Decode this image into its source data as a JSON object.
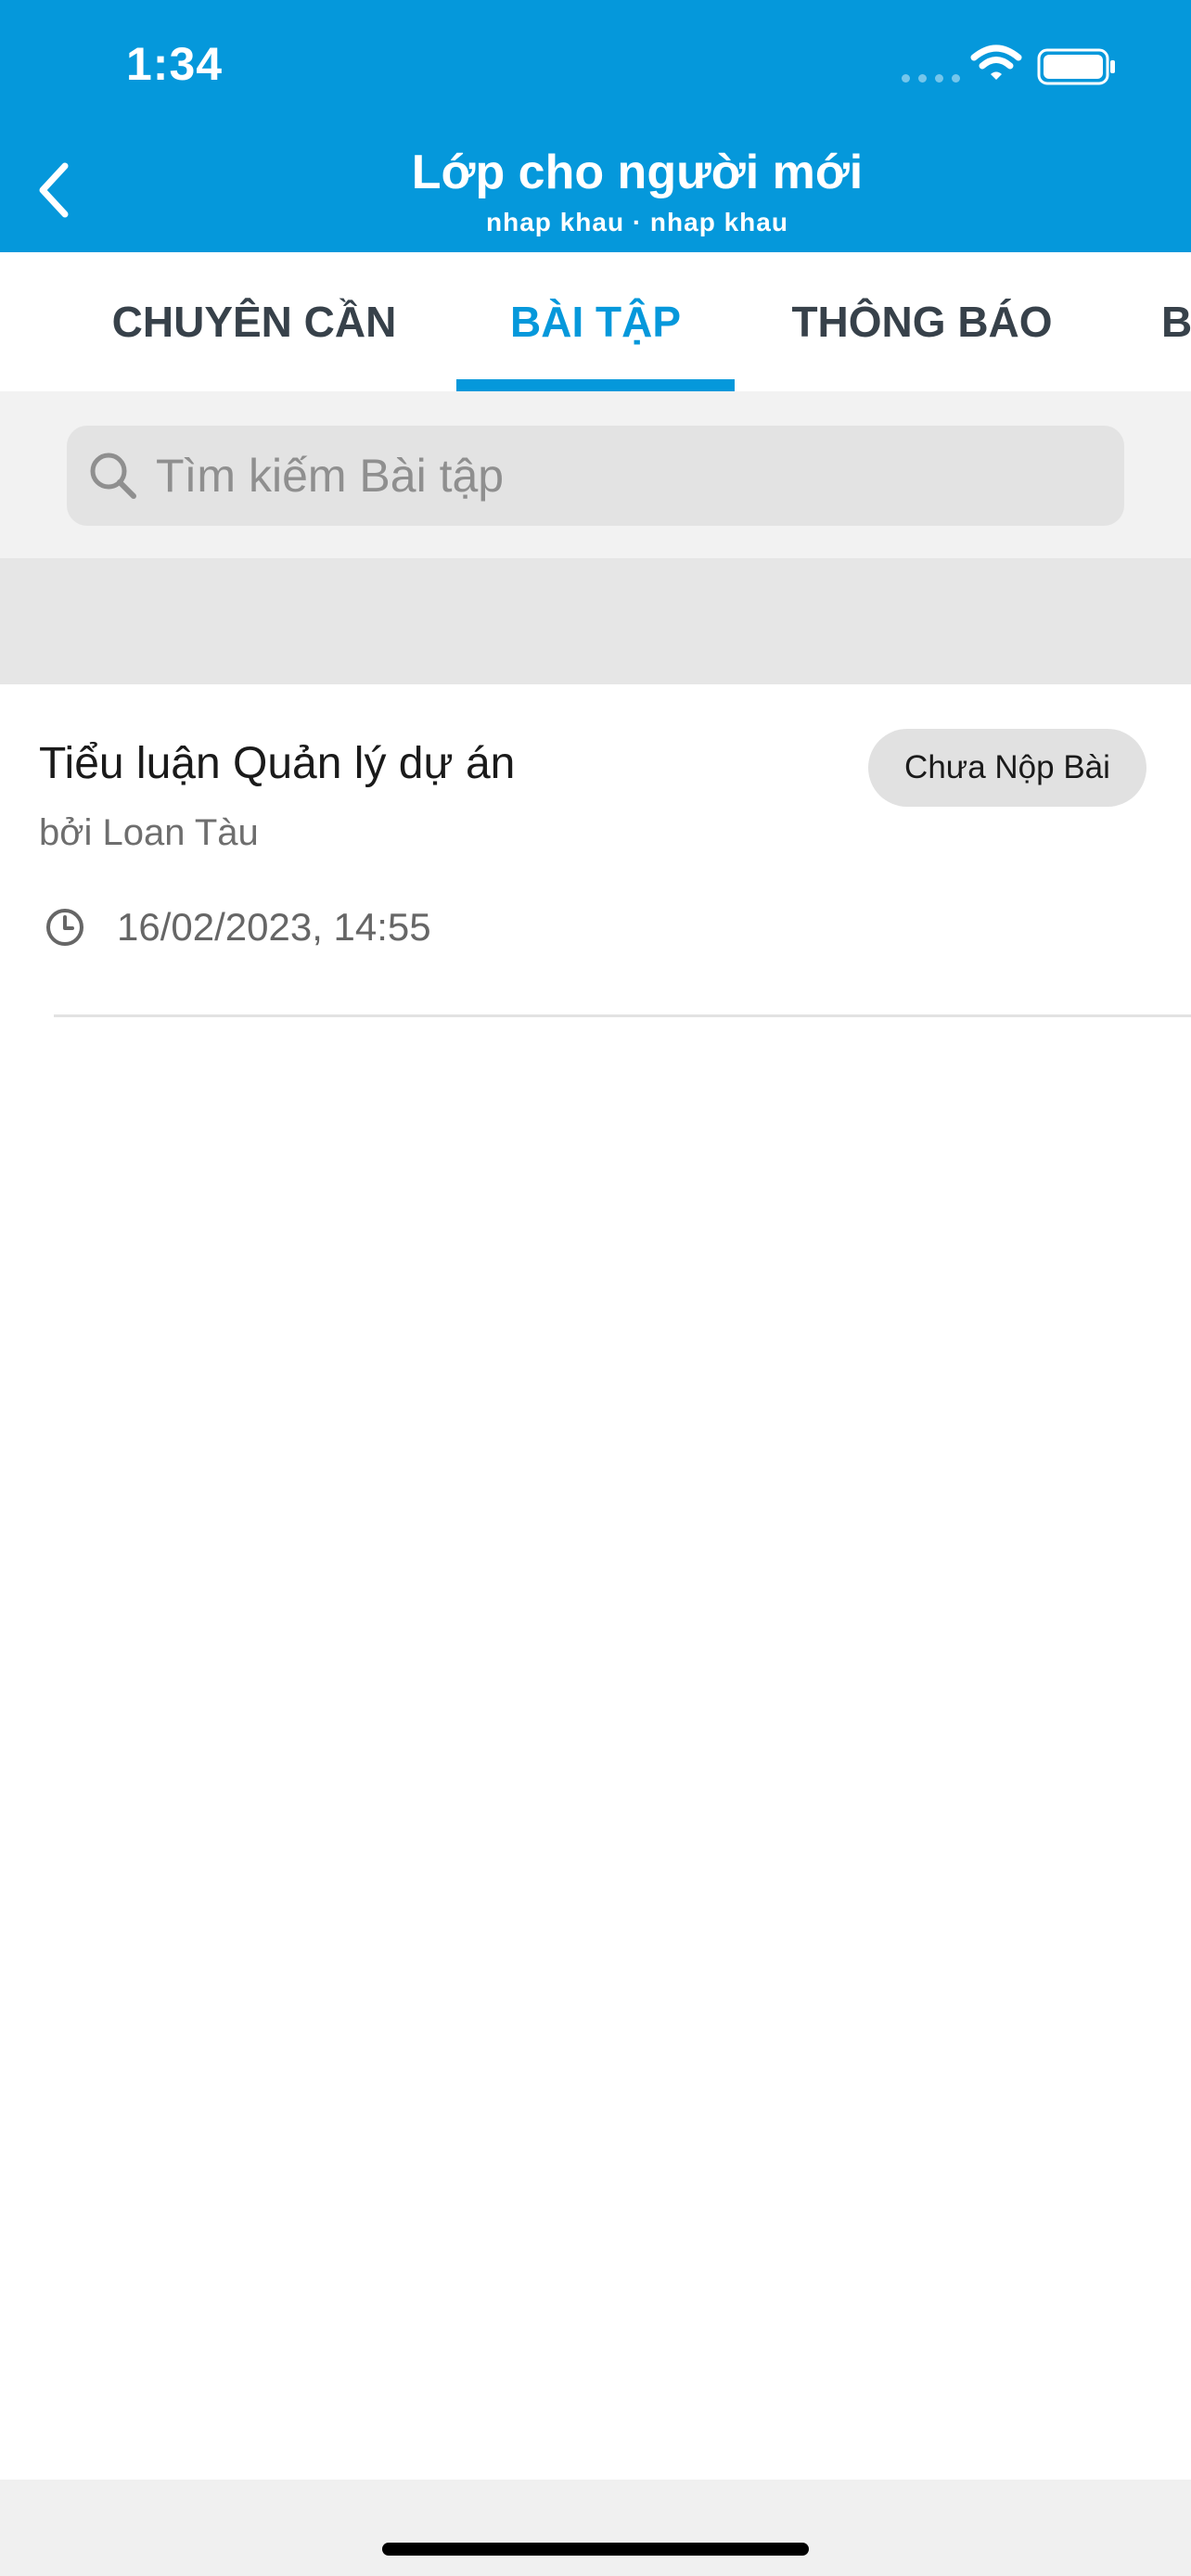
{
  "status_bar": {
    "time": "1:34"
  },
  "header": {
    "title": "Lớp cho người mới",
    "subtitle": "nhap khau · nhap khau",
    "back_icon": "chevron-left-icon"
  },
  "tabs": [
    {
      "label": "CHUYÊN CẦN",
      "active": false
    },
    {
      "label": "BÀI TẬP",
      "active": true
    },
    {
      "label": "THÔNG BÁO",
      "active": false
    },
    {
      "label": "B",
      "active": false
    }
  ],
  "search": {
    "placeholder": "Tìm kiếm Bài tập",
    "value": "",
    "icon": "search-icon"
  },
  "assignments": [
    {
      "title": "Tiểu luận Quản lý dự án",
      "author": "bởi Loan Tàu",
      "status": "Chưa Nộp Bài",
      "due": "16/02/2023, 14:55"
    }
  ],
  "colors": {
    "brand": "#0598db",
    "tab_text": "#37414a",
    "badge_bg": "#e1e1e1"
  }
}
